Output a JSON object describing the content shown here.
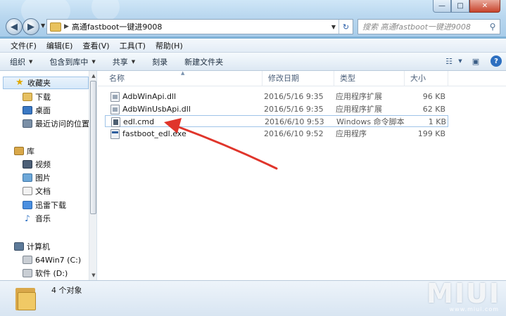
{
  "window": {
    "caption_min": "—",
    "caption_max": "□",
    "caption_close": "✕"
  },
  "address": {
    "path": "高通fastboot一键进9008",
    "search_placeholder": "搜索 高通fastboot一键进9008"
  },
  "menu": [
    "文件(F)",
    "编辑(E)",
    "查看(V)",
    "工具(T)",
    "帮助(H)"
  ],
  "toolbar": {
    "items": [
      {
        "label": "组织",
        "has_caret": true
      },
      {
        "label": "包含到库中",
        "has_caret": true
      },
      {
        "label": "共享",
        "has_caret": true
      },
      {
        "label": "刻录",
        "has_caret": false
      },
      {
        "label": "新建文件夹",
        "has_caret": false
      }
    ]
  },
  "nav": {
    "favorites": "收藏夹",
    "downloads": "下载",
    "desktop": "桌面",
    "recent": "最近访问的位置",
    "libraries": "库",
    "videos": "视频",
    "pictures": "图片",
    "documents": "文档",
    "xunlei": "迅雷下载",
    "music": "音乐",
    "computer": "计算机",
    "drive_c": "64Win7  (C:)",
    "drive_d": "软件 (D:)"
  },
  "columns": {
    "name": "名称",
    "date": "修改日期",
    "type": "类型",
    "size": "大小"
  },
  "files": [
    {
      "name": "AdbWinApi.dll",
      "date": "2016/5/16 9:35",
      "type": "应用程序扩展",
      "size": "96 KB",
      "icon": "dll-file-icon"
    },
    {
      "name": "AdbWinUsbApi.dll",
      "date": "2016/5/16 9:35",
      "type": "应用程序扩展",
      "size": "62 KB",
      "icon": "dll-file-icon"
    },
    {
      "name": "edl.cmd",
      "date": "2016/6/10 9:53",
      "type": "Windows 命令脚本",
      "size": "1 KB",
      "icon": "cmd-file-icon",
      "selected": true
    },
    {
      "name": "fastboot_edl.exe",
      "date": "2016/6/10 9:52",
      "type": "应用程序",
      "size": "199 KB",
      "icon": "exe-file-icon"
    }
  ],
  "status": {
    "count_text": "4 个对象"
  },
  "watermark": {
    "text": "MIUI",
    "url": "www.miui.com"
  },
  "colors": {
    "annotation_arrow": "#e0352b",
    "selection_border": "#9fc4e8"
  }
}
